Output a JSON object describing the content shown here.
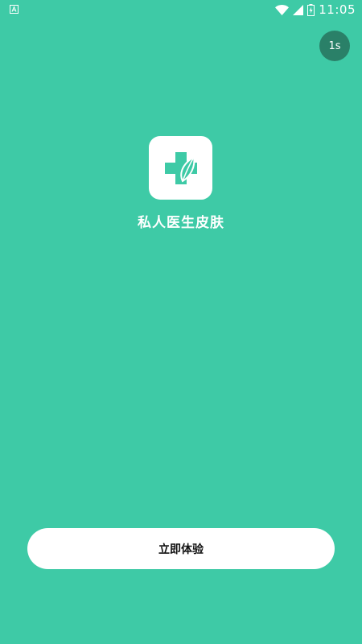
{
  "status_bar": {
    "time": "11:05",
    "left_icon": "a-notification-icon",
    "icons": [
      "wifi-icon",
      "signal-icon",
      "battery-charging-icon"
    ]
  },
  "skip_badge": {
    "label": "1s"
  },
  "app": {
    "logo_icon": "medical-cross-leaf-icon",
    "name": "私人医生皮肤"
  },
  "cta": {
    "label": "立即体验"
  },
  "colors": {
    "background": "#3ECAA6",
    "badge": "#2A8068",
    "button": "#FFFFFF",
    "text_light": "#FFFFFF",
    "text_dark": "#111111"
  }
}
